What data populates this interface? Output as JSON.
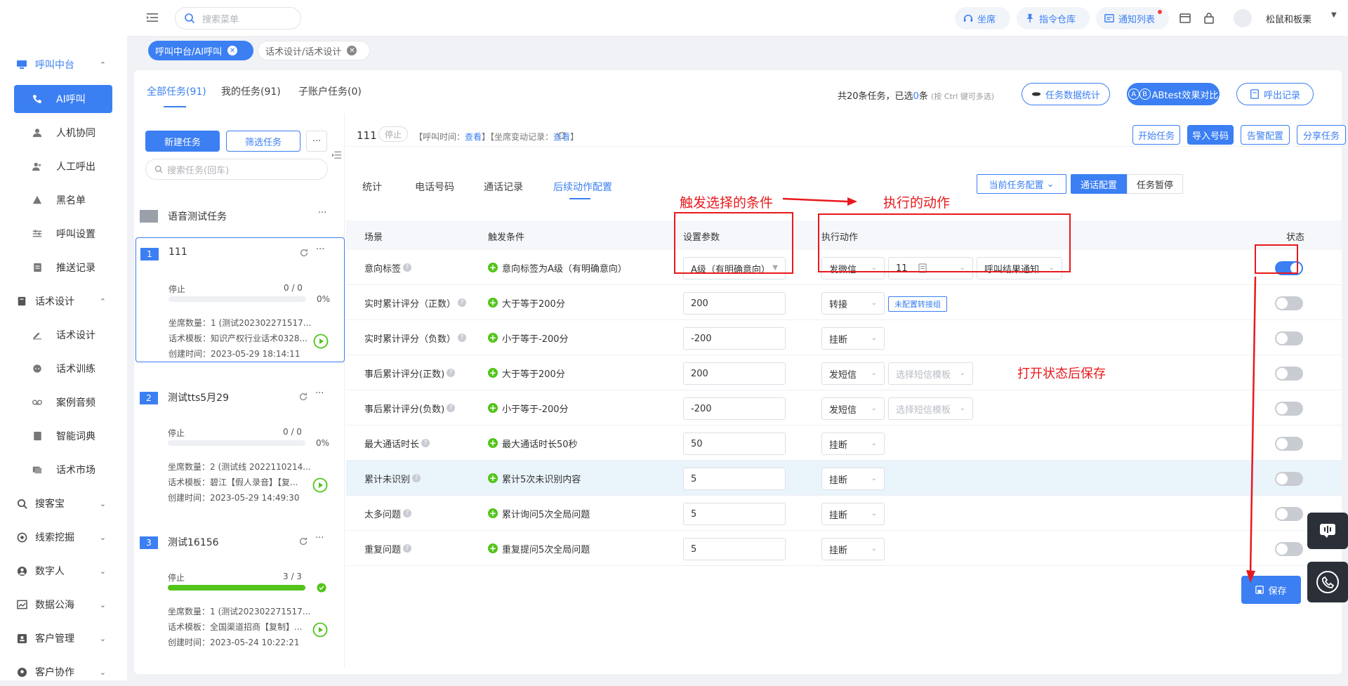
{
  "sidebar": {
    "groups": [
      {
        "label": "呼叫中台",
        "icon": "monitor-icon"
      },
      {
        "label": "话术设计",
        "icon": "book-icon"
      },
      {
        "label": "搜客宝",
        "icon": "search-icon"
      },
      {
        "label": "线索挖掘",
        "icon": "target-icon"
      },
      {
        "label": "数字人",
        "icon": "user-icon"
      },
      {
        "label": "数据公海",
        "icon": "chart-icon"
      },
      {
        "label": "客户管理",
        "icon": "contacts-icon"
      },
      {
        "label": "客户协作",
        "icon": "team-icon"
      }
    ],
    "call_items": [
      {
        "label": "AI呼叫",
        "icon": "phone-icon"
      },
      {
        "label": "人机协同",
        "icon": "person-icon"
      },
      {
        "label": "人工呼出",
        "icon": "people-icon"
      },
      {
        "label": "黑名单",
        "icon": "warning-icon"
      },
      {
        "label": "呼叫设置",
        "icon": "sliders-icon"
      },
      {
        "label": "推送记录",
        "icon": "doc-icon"
      }
    ],
    "script_items": [
      {
        "label": "话术设计",
        "icon": "pen-icon"
      },
      {
        "label": "话术训练",
        "icon": "chat-icon"
      },
      {
        "label": "案例音频",
        "icon": "audio-icon"
      },
      {
        "label": "智能词典",
        "icon": "dictionary-icon"
      },
      {
        "label": "话术市场",
        "icon": "market-icon"
      }
    ]
  },
  "topbar": {
    "search_placeholder": "搜索菜单",
    "seat": "坐席",
    "command": "指令仓库",
    "notify": "通知列表",
    "user": "松鼠和板栗"
  },
  "page_tabs": [
    {
      "label": "呼叫中台/AI呼叫"
    },
    {
      "label": "话术设计/话术设计"
    }
  ],
  "main": {
    "tabs": [
      "全部任务(91)",
      "我的任务(91)",
      "子账户任务(0)"
    ],
    "summary_prefix": "共20条任务，已选",
    "summary_count": "0",
    "summary_suffix": "条",
    "summary_hint": "(按 Ctrl 键可多选)",
    "stats_btn": "任务数据统计",
    "abtest_btn": "ABtest效果对比",
    "abtest_badge": "A",
    "abtest_badge2": "B",
    "callout_btn": "呼出记录"
  },
  "left": {
    "new_task": "新建任务",
    "filter_task": "筛选任务",
    "more": "···",
    "search_placeholder": "搜索任务(回车)",
    "group_title": "语音测试任务",
    "tasks": [
      {
        "num": "1",
        "name": "111",
        "status": "停止",
        "count": "0 / 0",
        "pct": "0%",
        "progress": 0,
        "seats": "坐席数量：1 (测试202302271517...",
        "template": "话术模板：知识产权行业话术0328...",
        "created": "创建时间：2023-05-29 18:14:11"
      },
      {
        "num": "2",
        "name": "测试tts5月29",
        "status": "停止",
        "count": "0 / 0",
        "pct": "0%",
        "progress": 0,
        "seats": "坐席数量：2 (测试线 2022110214...",
        "template": "话术模板：碧江【假人录音】【复...",
        "created": "创建时间：2023-05-29 14:49:30"
      },
      {
        "num": "3",
        "name": "测试16156",
        "status": "停止",
        "count": "3 / 3",
        "pct": "",
        "progress": 1,
        "seats": "坐席数量：1 (测试202302271517...",
        "template": "话术模板：全国渠道招商【复制】...",
        "created": "创建时间：2023-05-24 10:22:21"
      }
    ]
  },
  "right": {
    "task_name": "111",
    "status": "停止",
    "call_time_label": "【呼叫时间：",
    "call_time_link": "查看",
    "seat_change_label": "】【坐席变动记录：",
    "seat_change_link": "查看",
    "close_bracket": "】",
    "buttons": {
      "start": "开始任务",
      "import": "导入号码",
      "alarm": "告警配置",
      "share": "分享任务",
      "expand": "展开"
    },
    "subtabs": [
      "统计",
      "电话号码",
      "通话记录",
      "后续动作配置"
    ],
    "config_select": "当前任务配置",
    "call_config": "通话配置",
    "task_pause": "任务暂停",
    "columns": [
      "场景",
      "触发条件",
      "设置参数",
      "执行动作",
      "状态"
    ],
    "rows": [
      {
        "scene": "意向标签",
        "trigger": "意向标签为A级（有明确意向）",
        "param": "A级（有明确意向）",
        "action": "发微信",
        "extra1": "11",
        "extra2": "呼叫结果通知",
        "on": true,
        "hl": false
      },
      {
        "scene": "实时累计评分（正数）",
        "trigger": "大于等于200分",
        "param": "200",
        "action": "转接",
        "extra_tag": "未配置转接组",
        "on": false,
        "hl": false
      },
      {
        "scene": "实时累计评分（负数）",
        "trigger": "小于等于-200分",
        "param": "-200",
        "action": "挂断",
        "on": false,
        "hl": false
      },
      {
        "scene": "事后累计评分(正数)",
        "trigger": "大于等于200分",
        "param": "200",
        "action": "发短信",
        "extra_ph": "选择短信模板",
        "on": false,
        "hl": false
      },
      {
        "scene": "事后累计评分(负数)",
        "trigger": "小于等于-200分",
        "param": "-200",
        "action": "发短信",
        "extra_ph": "选择短信模板",
        "on": false,
        "hl": false
      },
      {
        "scene": "最大通话时长",
        "trigger": "最大通话时长50秒",
        "param": "50",
        "action": "挂断",
        "on": false,
        "hl": false
      },
      {
        "scene": "累计未识别",
        "trigger": "累计5次未识别内容",
        "param": "5",
        "action": "挂断",
        "on": false,
        "hl": true
      },
      {
        "scene": "太多问题",
        "trigger": "累计询问5次全局问题",
        "param": "5",
        "action": "挂断",
        "on": false,
        "hl": false
      },
      {
        "scene": "重复问题",
        "trigger": "重复提问5次全局问题",
        "param": "5",
        "action": "挂断",
        "on": false,
        "hl": false
      }
    ],
    "save": "保存"
  },
  "annotations": {
    "conditions": "触发选择的条件",
    "actions": "执行的动作",
    "save_note": "打开状态后保存",
    "color": "#e8191c"
  },
  "colors": {
    "primary": "#3b7ff3",
    "success": "#52c41a",
    "annotation": "#e8191c"
  }
}
